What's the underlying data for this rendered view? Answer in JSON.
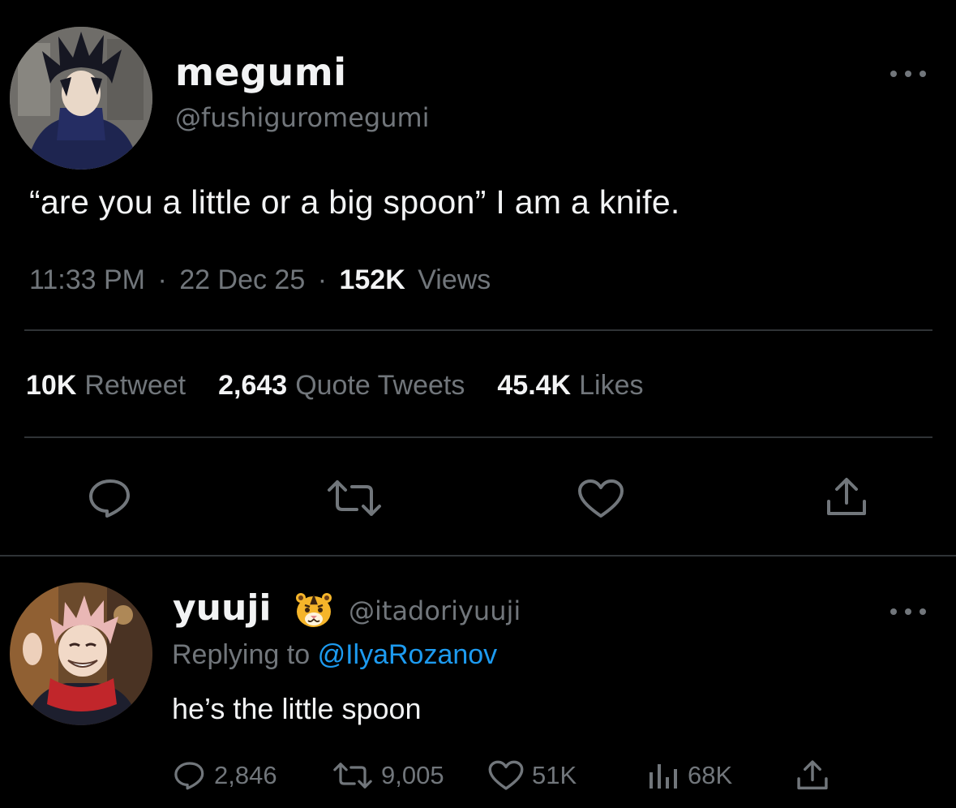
{
  "main_tweet": {
    "display_name": "megumi",
    "handle": "@fushiguromegumi",
    "text": "“are you a little or a big spoon” I am a knife.",
    "time": "11:33 PM",
    "separator": "·",
    "date": "22 Dec 25",
    "views_count": "152K",
    "views_label": "Views",
    "stats": {
      "retweets_count": "10K",
      "retweets_label": "Retweet",
      "quotes_count": "2,643",
      "quotes_label": "Quote Tweets",
      "likes_count": "45.4K",
      "likes_label": "Likes"
    },
    "actions": [
      "reply-icon",
      "retweet-icon",
      "heart-icon",
      "share-icon"
    ]
  },
  "reply": {
    "display_name": "yuuji",
    "emoji": "🐯",
    "handle": "@itadoriyuuji",
    "replying_prefix": "Replying to",
    "replying_to": "@IlyaRozanov",
    "text": "he’s the little spoon",
    "replies": "2,846",
    "retweets": "9,005",
    "likes": "51K",
    "views": "68K"
  },
  "colors": {
    "background": "#000000",
    "primary_text": "#f2f3f4",
    "secondary_text": "#71767b",
    "link": "#1d9bf0",
    "divider": "#2f3336"
  }
}
